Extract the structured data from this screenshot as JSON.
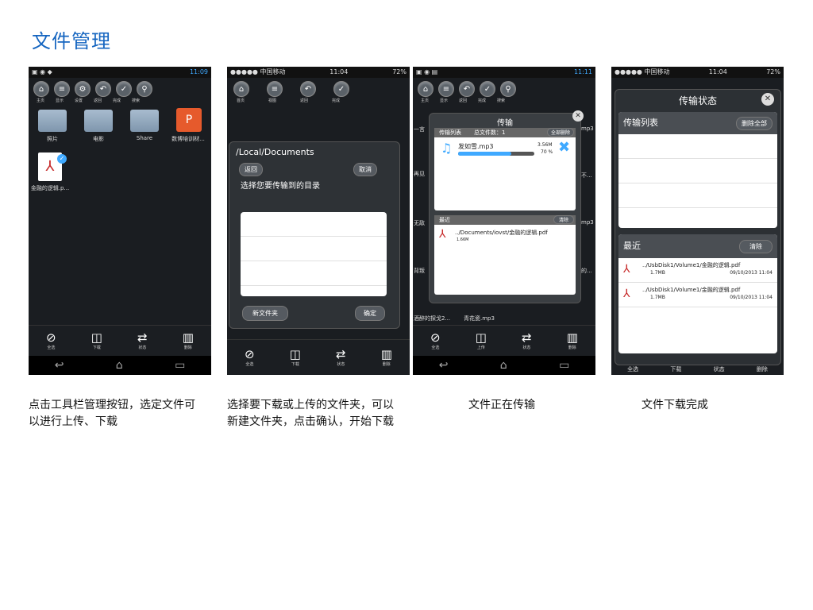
{
  "page_title": "文件管理",
  "screen1": {
    "status_time": "11:09",
    "toolbar": [
      "主页",
      "显示",
      "设置",
      "返回",
      "完成",
      "搜索"
    ],
    "folders": [
      "照片",
      "电影",
      "Share",
      "数博培训材..."
    ],
    "file_name": "金融的逻辑.p...",
    "bottom": [
      "全选",
      "下载",
      "状态",
      "删除"
    ]
  },
  "screen2": {
    "status_carrier": "●●●●● 中国移动",
    "status_time": "11:04",
    "status_battery": "72%",
    "toolbar": [
      "首页",
      "视图",
      "返回",
      "完成"
    ],
    "dialog_path": "/Local/Documents",
    "back_btn": "返回",
    "cancel_btn": "取消",
    "prompt": "选择您要传输到的目录",
    "new_folder_btn": "新文件夹",
    "confirm_btn": "确定",
    "bottom": [
      "全选",
      "下载",
      "状态",
      "删除"
    ]
  },
  "screen3": {
    "status_time": "11:11",
    "toolbar": [
      "主页",
      "显示",
      "返回",
      "完成",
      "搜索"
    ],
    "dialog_title": "传输",
    "list_label": "传输列表",
    "total_label": "总文件数：1",
    "delete_all": "全部删除",
    "file_name": "发如雪.mp3",
    "file_size": "3.56M",
    "progress_text": "70 %",
    "progress": 0.7,
    "recent_label": "最近",
    "clear_btn": "清除",
    "recent_path": "../Documents/iovst/金融的逻辑.pdf",
    "recent_size": "1.66M",
    "bg_items": [
      "一言",
      "再见",
      "无敌",
      "背叛",
      "酒醉的探戈2...",
      "青花瓷.mp3"
    ],
    "bg_right": [
      "mp3",
      "不...",
      "mp3",
      "的..."
    ],
    "bottom": [
      "全选",
      "上传",
      "状态",
      "删除"
    ]
  },
  "screen4": {
    "status_carrier": "●●●●● 中国移动",
    "status_time": "11:04",
    "status_battery": "72%",
    "dialog_title": "传输状态",
    "list_label": "传输列表",
    "delete_all": "删除全部",
    "recent_label": "最近",
    "clear_btn": "清除",
    "items": [
      {
        "path": "../UsbDisk1/Volume1/金融的逻辑.pdf",
        "size": "1.7MB",
        "date": "09/10/2013 11:04"
      },
      {
        "path": "../UsbDisk1/Volume1/金融的逻辑.pdf",
        "size": "1.7MB",
        "date": "09/10/2013 11:04"
      }
    ],
    "bottom": [
      "全选",
      "下载",
      "状态",
      "删除"
    ]
  },
  "captions": {
    "c1": "点击工具栏管理按钮，选定文件可以进行上传、下载",
    "c2": "选择要下载或上传的文件夹，可以新建文件夹，点击确认，开始下载",
    "c3": "文件正在传输",
    "c4": "文件下载完成"
  },
  "colors": {
    "title_blue": "#1565c0",
    "progress_blue": "#3fa9ff"
  }
}
